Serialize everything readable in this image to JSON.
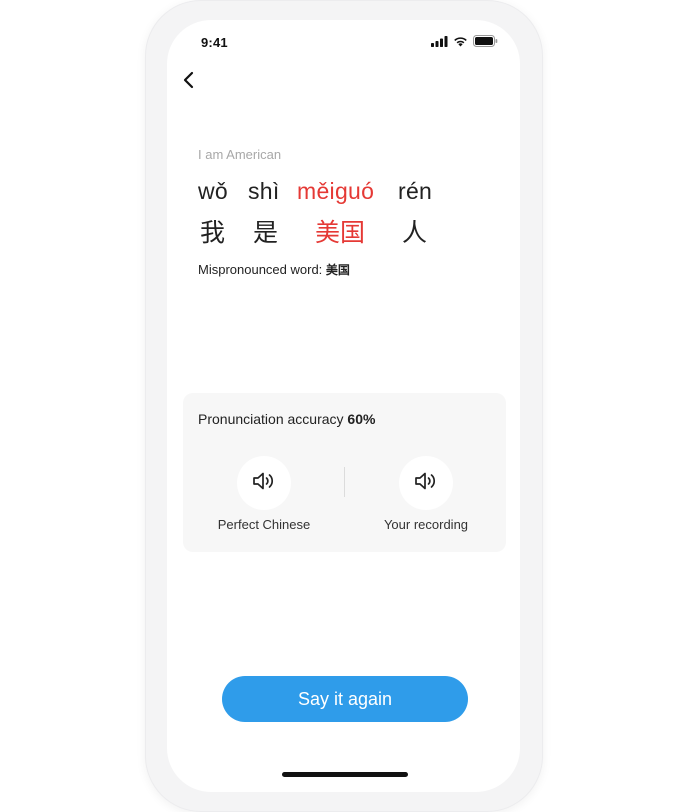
{
  "status_bar": {
    "time": "9:41",
    "icons": [
      "cellular-signal-icon",
      "wifi-icon",
      "battery-icon"
    ]
  },
  "nav": {
    "back_icon": "chevron-left-icon"
  },
  "phrase": {
    "translation": "I am American",
    "words": [
      {
        "pinyin": "wǒ",
        "hanzi": "我",
        "mispronounced": false
      },
      {
        "pinyin": "shì",
        "hanzi": "是",
        "mispronounced": false
      },
      {
        "pinyin": "měiguó",
        "hanzi": "美国",
        "mispronounced": true
      },
      {
        "pinyin": "rén",
        "hanzi": "人",
        "mispronounced": false
      }
    ],
    "mispronounced_label": "Mispronounced word: ",
    "mispronounced_word": "美国"
  },
  "accuracy": {
    "label": "Pronunciation accuracy ",
    "value": "60%",
    "perfect": {
      "label": "Perfect Chinese",
      "icon": "speaker-icon"
    },
    "recording": {
      "label": "Your recording",
      "icon": "speaker-icon"
    }
  },
  "actions": {
    "say_again": "Say it again"
  },
  "colors": {
    "error": "#e53935",
    "accent": "#2f9cea",
    "card": "#f7f7f7"
  }
}
